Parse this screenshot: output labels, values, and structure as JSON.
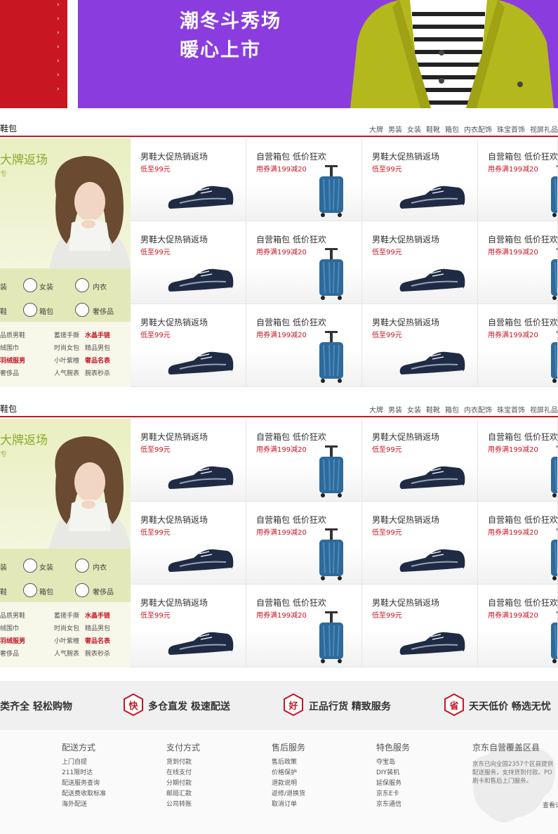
{
  "banner": {
    "line1": "潮冬斗秀场",
    "line2": "暖心上市",
    "menu_arrow": "›",
    "colors": {
      "menu": "#c81623",
      "banner_bg": "#8a3cdf",
      "coat": "#b3b81c"
    }
  },
  "floors": [
    {
      "title": "鞋包",
      "tabs": [
        "大牌",
        "男装",
        "女装",
        "鞋靴",
        "箱包",
        "内衣配饰",
        "珠宝首饰",
        "视屏礼品"
      ],
      "promo": {
        "title": "大牌返场",
        "sub": "专"
      },
      "categories": [
        "装",
        "女装",
        "内衣",
        "鞋",
        "箱包",
        "奢侈品"
      ],
      "links": [
        [
          "品质男鞋",
          "蓄搓手撕",
          "水晶手链"
        ],
        [
          "绒围巾",
          "时尚女包",
          "精品男包"
        ],
        [
          "羽绒服男",
          "小叶紫檀",
          "奢品名表"
        ],
        [
          "奢侈品",
          "人气腕表",
          "腕表秒杀"
        ]
      ],
      "red_links": [
        "水晶手链",
        "羽绒服男",
        "奢品名表"
      ]
    },
    {
      "title": "鞋包",
      "tabs": [
        "大牌",
        "男装",
        "女装",
        "鞋靴",
        "箱包",
        "内衣配饰",
        "珠宝首饰",
        "视屏礼品"
      ],
      "promo": {
        "title": "大牌返场",
        "sub": "专"
      },
      "categories": [
        "装",
        "女装",
        "内衣",
        "鞋",
        "箱包",
        "奢侈品"
      ],
      "links": [
        [
          "品质男鞋",
          "蓄搓手撕",
          "水晶手链"
        ],
        [
          "绒围巾",
          "时尚女包",
          "精品男包"
        ],
        [
          "羽绒服男",
          "小叶紫檀",
          "奢品名表"
        ],
        [
          "奢侈品",
          "人气腕表",
          "腕表秒杀"
        ]
      ],
      "red_links": [
        "水晶手链",
        "羽绒服男",
        "奢品名表"
      ]
    }
  ],
  "products": {
    "shoe": {
      "title": "男鞋大促热销返场",
      "sub": "低至99元"
    },
    "bag": {
      "title": "自营箱包 低价狂欢",
      "sub": "用券满199减20"
    }
  },
  "services": [
    {
      "badge": "",
      "text": "类齐全  轻松购物"
    },
    {
      "badge": "快",
      "text": "多仓直发  极速配送"
    },
    {
      "badge": "好",
      "text": "正品行货  精致服务"
    },
    {
      "badge": "省",
      "text": "天天低价  畅选无忧"
    }
  ],
  "footer": {
    "columns": [
      {
        "title": "配送方式",
        "items": [
          "上门自提",
          "211限时达",
          "配送服务查询",
          "配送费收取标准",
          "海外配送"
        ]
      },
      {
        "title": "支付方式",
        "items": [
          "货到付款",
          "在线支付",
          "分期付款",
          "邮局汇款",
          "公司转账"
        ]
      },
      {
        "title": "售后服务",
        "items": [
          "售后政策",
          "价格保护",
          "退款说明",
          "返修/退换货",
          "取消订单"
        ]
      },
      {
        "title": "特色服务",
        "items": [
          "夺宝岛",
          "DIY装机",
          "延保服务",
          "京东E卡",
          "京东通信"
        ]
      }
    ],
    "coverage": {
      "title": "京东自营覆盖区县",
      "lines": [
        "京东已向全国2357个区县提供",
        "配送服务，支持货到付款、PO",
        "刷卡和售后上门服务。"
      ],
      "more": "查看详"
    }
  }
}
